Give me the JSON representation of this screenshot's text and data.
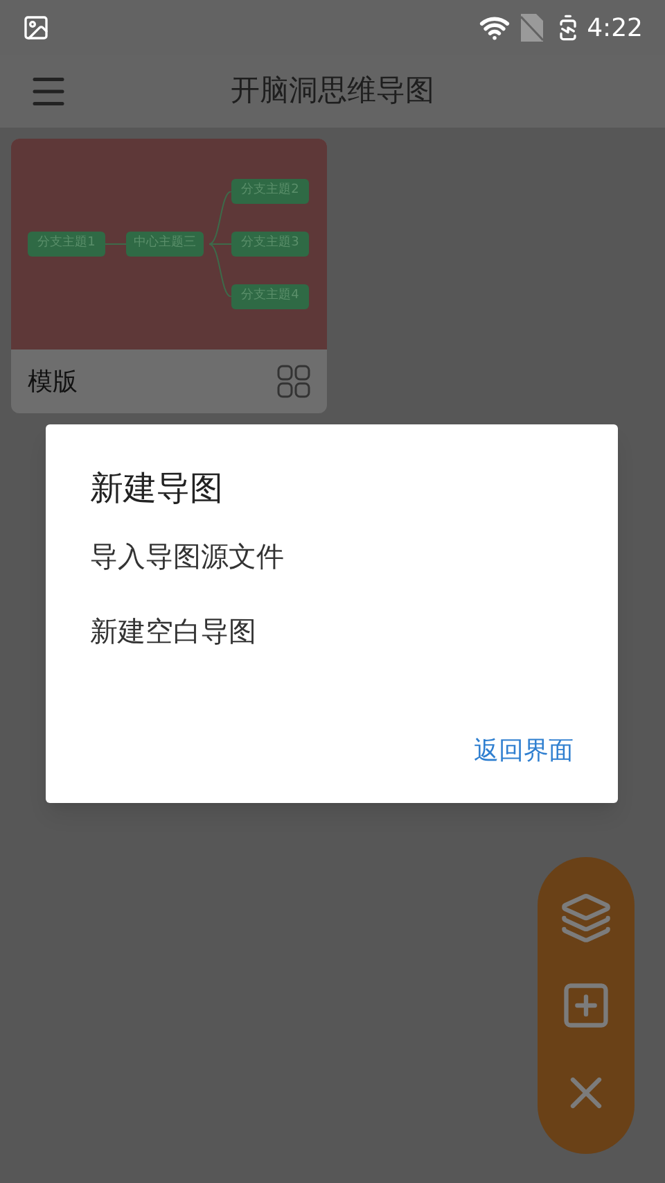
{
  "status_bar": {
    "time": "4:22"
  },
  "app_bar": {
    "title": "开脑洞思维导图"
  },
  "template_card": {
    "label": "模版",
    "mind_map": {
      "center": "中心主题三",
      "left": [
        "分支主題1"
      ],
      "right": [
        "分支主題2",
        "分支主題3",
        "分支主題4"
      ]
    }
  },
  "dialog": {
    "title": "新建导图",
    "options": [
      "导入导图源文件",
      "新建空白导图"
    ],
    "button": "返回界面"
  }
}
